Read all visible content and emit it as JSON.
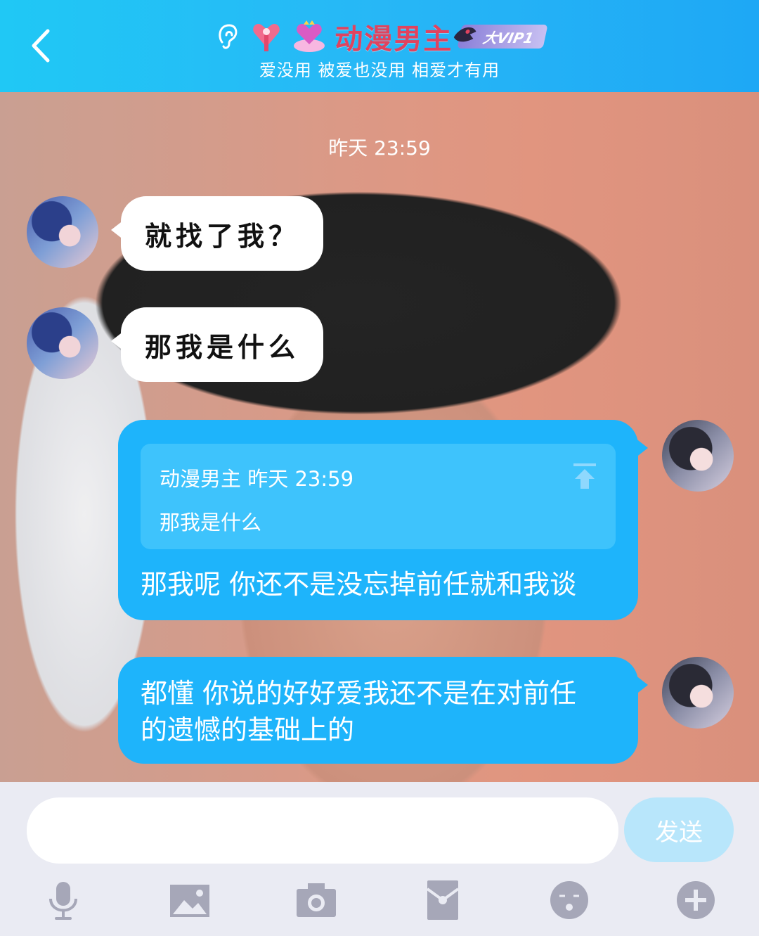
{
  "header": {
    "nickname": "动漫男主",
    "vip_label": "大VIP1",
    "signature": "爱没用 被爱也没用 相爱才有用"
  },
  "chat": {
    "timestamp": "昨天 23:59",
    "messages": [
      {
        "side": "left",
        "text": "就找了我？"
      },
      {
        "side": "left",
        "text": "那我是什么"
      },
      {
        "side": "right",
        "quote": {
          "author": "动漫男主",
          "time": "昨天 23:59",
          "text": "那我是什么"
        },
        "text": "那我呢 你还不是没忘掉前任就和我谈"
      },
      {
        "side": "right",
        "text_line1": "都懂 你说的好好爱我还不是在对前任",
        "text_line2": "的遗憾的基础上的"
      }
    ]
  },
  "input": {
    "value": "",
    "send_label": "发送"
  },
  "toolbar": {
    "icons": [
      "microphone-icon",
      "image-icon",
      "camera-icon",
      "red-packet-icon",
      "emoji-icon",
      "plus-icon"
    ],
    "icon_color": "#a6a7b8"
  },
  "colors": {
    "header": "#22bdf6",
    "bubble_out": "#1eb4fb",
    "nickname": "#e0435f"
  }
}
